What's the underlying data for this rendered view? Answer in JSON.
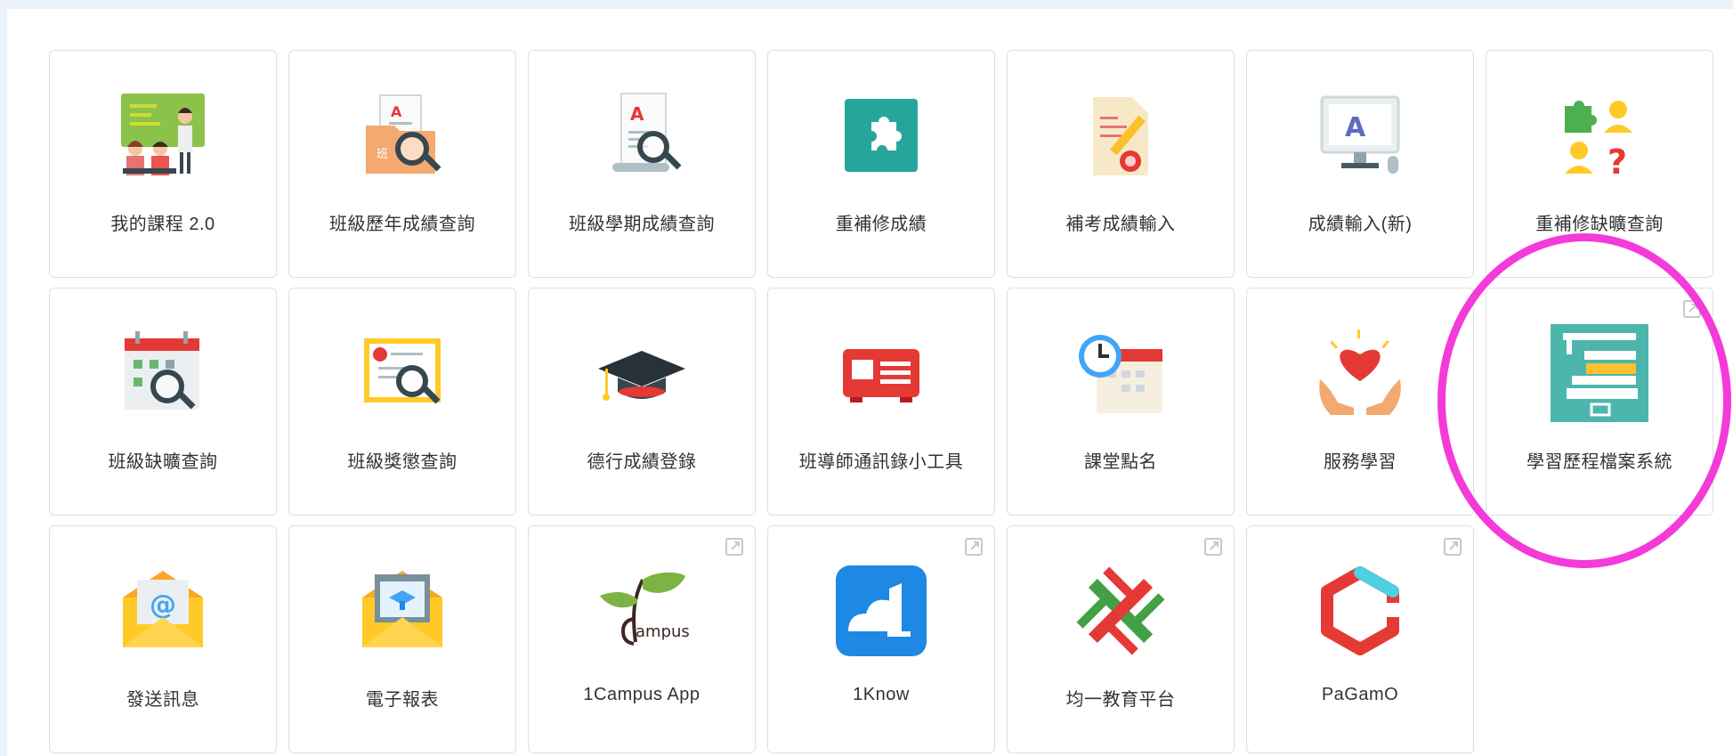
{
  "apps": [
    {
      "label": "我的課程 2.0",
      "icon": "classroom-teacher-icon",
      "external": false
    },
    {
      "label": "班級歷年成績查詢",
      "icon": "grade-folder-search-icon",
      "external": false
    },
    {
      "label": "班級學期成績查詢",
      "icon": "grade-scroll-search-icon",
      "external": false
    },
    {
      "label": "重補修成績",
      "icon": "puzzle-icon",
      "external": false
    },
    {
      "label": "補考成績輸入",
      "icon": "document-pencil-icon",
      "external": false
    },
    {
      "label": "成績輸入(新)",
      "icon": "grade-monitor-icon",
      "external": false
    },
    {
      "label": "重補修缺曠查詢",
      "icon": "puzzle-people-question-icon",
      "external": false
    },
    {
      "label": "班級缺曠查詢",
      "icon": "calendar-search-icon",
      "external": false
    },
    {
      "label": "班級獎懲查詢",
      "icon": "certificate-search-icon",
      "external": false
    },
    {
      "label": "德行成績登錄",
      "icon": "graduation-cap-icon",
      "external": false
    },
    {
      "label": "班導師通訊錄小工具",
      "icon": "contact-card-icon",
      "external": false
    },
    {
      "label": "課堂點名",
      "icon": "clock-calendar-icon",
      "external": false
    },
    {
      "label": "服務學習",
      "icon": "hands-heart-icon",
      "external": false
    },
    {
      "label": "學習歷程檔案系統",
      "icon": "books-cabinet-icon",
      "external": true
    },
    {
      "label": "發送訊息",
      "icon": "email-at-icon",
      "external": false
    },
    {
      "label": "電子報表",
      "icon": "email-report-icon",
      "external": false
    },
    {
      "label": "1Campus App",
      "icon": "1campus-logo-icon",
      "external": true
    },
    {
      "label": "1Know",
      "icon": "1know-logo-icon",
      "external": true
    },
    {
      "label": "均一教育平台",
      "icon": "junyi-logo-icon",
      "external": true
    },
    {
      "label": "PaGamO",
      "icon": "pagamo-logo-icon",
      "external": true
    }
  ],
  "external_link_icon": "external-link-icon",
  "highlight_color": "#f43ad9"
}
